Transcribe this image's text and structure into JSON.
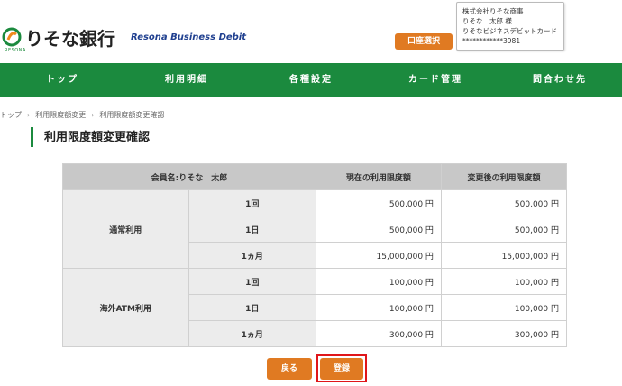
{
  "header": {
    "logo_text": "りそな銀行",
    "logo_sub": "RESONA",
    "brand": "Resona Business Debit",
    "account_select_label": "口座選択",
    "user": {
      "company": "株式会社りそな商事",
      "name": "りそな　太郎 様",
      "card_type": "りそなビジネスデビットカード",
      "card_number": "************3981"
    }
  },
  "nav": {
    "items": [
      {
        "label": "トップ"
      },
      {
        "label": "利用明細"
      },
      {
        "label": "各種設定"
      },
      {
        "label": "カード管理"
      },
      {
        "label": "問合わせ先"
      }
    ]
  },
  "breadcrumb": [
    "トップ",
    "利用限度額変更",
    "利用限度額変更確認"
  ],
  "breadcrumb_separator": "›",
  "page_title": "利用限度額変更確認",
  "table": {
    "member_header": "会員名:りそな　太郎",
    "current_header": "現在の利用限度額",
    "new_header": "変更後の利用限度額",
    "groups": [
      {
        "label": "通常利用",
        "rows": [
          {
            "period": "1回",
            "current": "500,000 円",
            "new": "500,000 円"
          },
          {
            "period": "1日",
            "current": "500,000 円",
            "new": "500,000 円"
          },
          {
            "period": "1ヵ月",
            "current": "15,000,000 円",
            "new": "15,000,000 円"
          }
        ]
      },
      {
        "label": "海外ATM利用",
        "rows": [
          {
            "period": "1回",
            "current": "100,000 円",
            "new": "100,000 円"
          },
          {
            "period": "1日",
            "current": "100,000 円",
            "new": "100,000 円"
          },
          {
            "period": "1ヵ月",
            "current": "300,000 円",
            "new": "300,000 円"
          }
        ]
      }
    ]
  },
  "buttons": {
    "back_label": "戻る",
    "register_label": "登録"
  },
  "colors": {
    "nav_green": "#1b8a3e",
    "button_orange": "#e07a22",
    "highlight_red": "#e0161a"
  }
}
